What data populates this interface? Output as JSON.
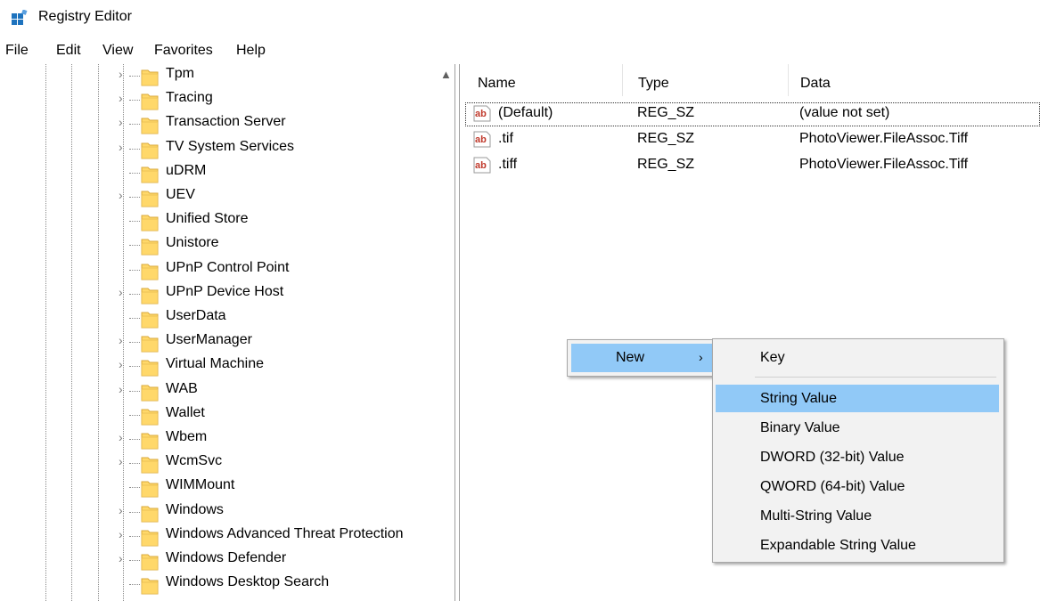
{
  "window": {
    "title": "Registry Editor",
    "icon": "registry-editor-icon"
  },
  "menu": [
    "File",
    "Edit",
    "View",
    "Favorites",
    "Help"
  ],
  "tree": {
    "items": [
      {
        "label": "Tpm",
        "expandable": true
      },
      {
        "label": "Tracing",
        "expandable": true
      },
      {
        "label": "Transaction Server",
        "expandable": true
      },
      {
        "label": "TV System Services",
        "expandable": true
      },
      {
        "label": "uDRM",
        "expandable": false
      },
      {
        "label": "UEV",
        "expandable": true
      },
      {
        "label": "Unified Store",
        "expandable": false
      },
      {
        "label": "Unistore",
        "expandable": false
      },
      {
        "label": "UPnP Control Point",
        "expandable": false
      },
      {
        "label": "UPnP Device Host",
        "expandable": true
      },
      {
        "label": "UserData",
        "expandable": false
      },
      {
        "label": "UserManager",
        "expandable": true
      },
      {
        "label": "Virtual Machine",
        "expandable": true
      },
      {
        "label": "WAB",
        "expandable": true
      },
      {
        "label": "Wallet",
        "expandable": false
      },
      {
        "label": "Wbem",
        "expandable": true
      },
      {
        "label": "WcmSvc",
        "expandable": true
      },
      {
        "label": "WIMMount",
        "expandable": false
      },
      {
        "label": "Windows",
        "expandable": true
      },
      {
        "label": "Windows Advanced Threat Protection",
        "expandable": true
      },
      {
        "label": "Windows Defender",
        "expandable": true
      },
      {
        "label": "Windows Desktop Search",
        "expandable": false
      }
    ]
  },
  "values": {
    "columns": {
      "name": "Name",
      "type": "Type",
      "data": "Data"
    },
    "rows": [
      {
        "name": "(Default)",
        "type": "REG_SZ",
        "data": "(value not set)"
      },
      {
        "name": ".tif",
        "type": "REG_SZ",
        "data": "PhotoViewer.FileAssoc.Tiff"
      },
      {
        "name": ".tiff",
        "type": "REG_SZ",
        "data": "PhotoViewer.FileAssoc.Tiff"
      }
    ]
  },
  "context_menu": {
    "new_label": "New",
    "arrow": "›",
    "submenu": [
      {
        "label": "Key"
      },
      {
        "label": "String Value"
      },
      {
        "label": "Binary Value"
      },
      {
        "label": "DWORD (32-bit) Value"
      },
      {
        "label": "QWORD (64-bit) Value"
      },
      {
        "label": "Multi-String Value"
      },
      {
        "label": "Expandable String Value"
      }
    ],
    "highlight_color": "#91c9f7"
  },
  "colors": {
    "folder": "#ffd86a",
    "ab_icon": "#c0392b"
  }
}
